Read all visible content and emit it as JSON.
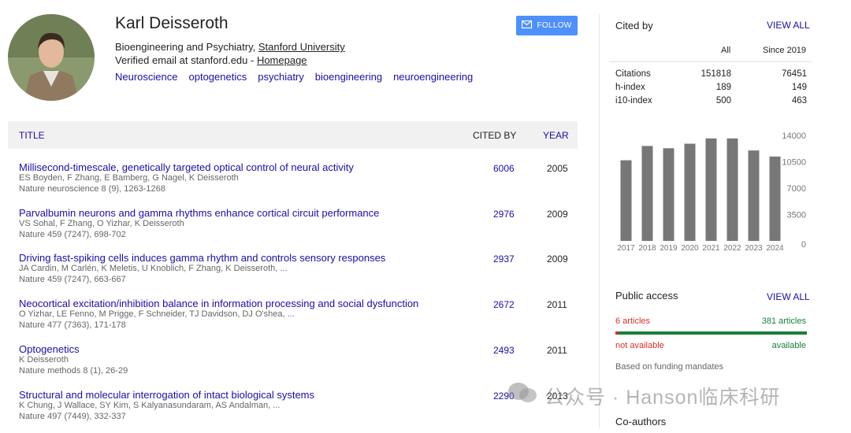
{
  "profile": {
    "name": "Karl Deisseroth",
    "affiliation_prefix": "Bioengineering and Psychiatry, ",
    "affiliation_link": "Stanford University",
    "email_prefix": "Verified email at stanford.edu - ",
    "homepage_link": "Homepage",
    "interests": [
      "Neuroscience",
      "optogenetics",
      "psychiatry",
      "bioengineering",
      "neuroengineering"
    ],
    "follow_label": "FOLLOW"
  },
  "table": {
    "headers": {
      "title": "TITLE",
      "cited_by": "CITED BY",
      "year": "YEAR"
    },
    "rows": [
      {
        "title": "Millisecond-timescale, genetically targeted optical control of neural activity",
        "authors": "ES Boyden, F Zhang, E Bamberg, G Nagel, K Deisseroth",
        "venue": "Nature neuroscience 8 (9), 1263-1268",
        "cited": "6006",
        "year": "2005"
      },
      {
        "title": "Parvalbumin neurons and gamma rhythms enhance cortical circuit performance",
        "authors": "VS Sohal, F Zhang, O Yizhar, K Deisseroth",
        "venue": "Nature 459 (7247), 698-702",
        "cited": "2976",
        "year": "2009"
      },
      {
        "title": "Driving fast-spiking cells induces gamma rhythm and controls sensory responses",
        "authors": "JA Cardin, M Carlén, K Meletis, U Knoblich, F Zhang, K Deisseroth, ...",
        "venue": "Nature 459 (7247), 663-667",
        "cited": "2937",
        "year": "2009"
      },
      {
        "title": "Neocortical excitation/inhibition balance in information processing and social dysfunction",
        "authors": "O Yizhar, LE Fenno, M Prigge, F Schneider, TJ Davidson, DJ O'shea, ...",
        "venue": "Nature 477 (7363), 171-178",
        "cited": "2672",
        "year": "2011"
      },
      {
        "title": "Optogenetics",
        "authors": "K Deisseroth",
        "venue": "Nature methods 8 (1), 26-29",
        "cited": "2493",
        "year": "2011"
      },
      {
        "title": "Structural and molecular interrogation of intact biological systems",
        "authors": "K Chung, J Wallace, SY Kim, S Kalyanasundaram, AS Andalman, ...",
        "venue": "Nature 497 (7449), 332-337",
        "cited": "2290",
        "year": "2013"
      }
    ]
  },
  "cited_by": {
    "title": "Cited by",
    "view_all": "VIEW ALL",
    "col_all": "All",
    "col_since": "Since 2019",
    "rows": [
      {
        "label": "Citations",
        "all": "151818",
        "since": "76451"
      },
      {
        "label": "h-index",
        "all": "189",
        "since": "149"
      },
      {
        "label": "i10-index",
        "all": "500",
        "since": "463"
      }
    ]
  },
  "chart_data": {
    "type": "bar",
    "categories": [
      "2017",
      "2018",
      "2019",
      "2020",
      "2021",
      "2022",
      "2023",
      "2024"
    ],
    "values": [
      10700,
      12600,
      12300,
      12900,
      13600,
      13600,
      12000,
      11200
    ],
    "yticks": [
      "14000",
      "10500",
      "7000",
      "3500",
      "0"
    ],
    "ylim": [
      0,
      14000
    ],
    "bar_color": "#777777"
  },
  "public_access": {
    "title": "Public access",
    "view_all": "VIEW ALL",
    "not_available_count": "6 articles",
    "available_count": "381 articles",
    "not_available_label": "not available",
    "available_label": "available",
    "funding_note": "Based on funding mandates",
    "available_fraction": 0.984
  },
  "coauthors": {
    "title": "Co-authors"
  },
  "watermark": {
    "text": "公众号 · Hanson临床科研"
  }
}
